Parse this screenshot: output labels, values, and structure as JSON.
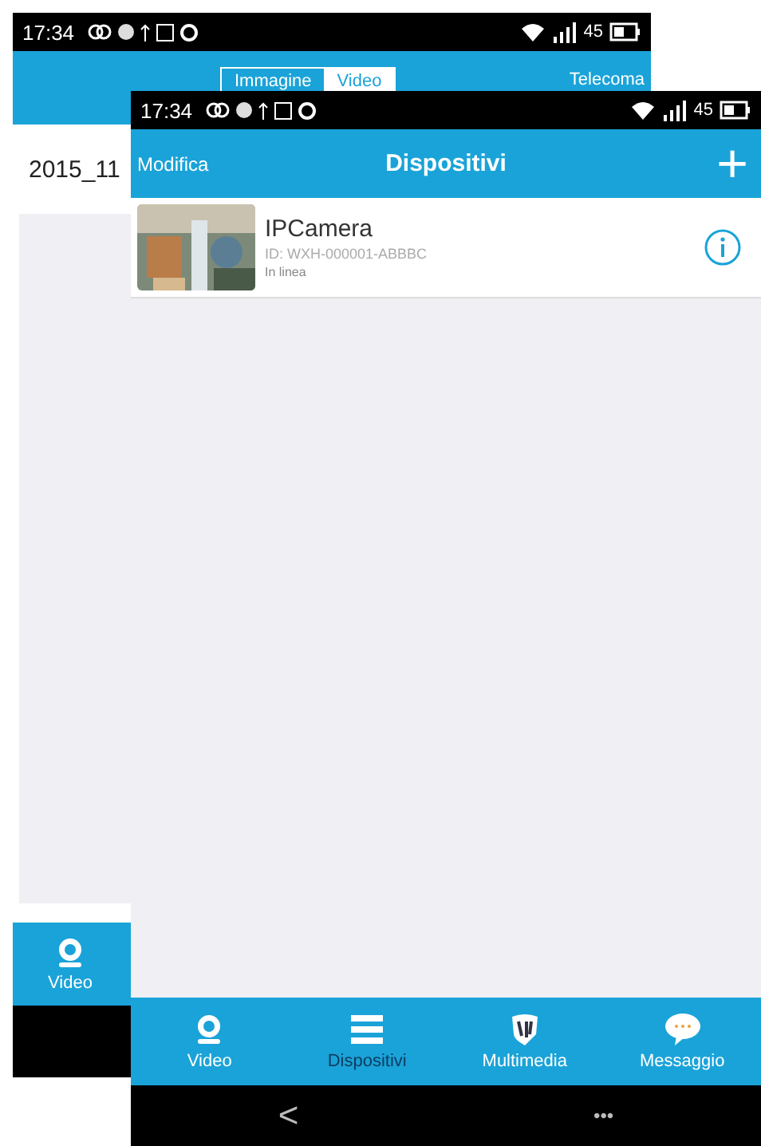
{
  "back_screen": {
    "status_bar": {
      "time": "17:34",
      "battery": "45"
    },
    "segments": [
      {
        "label": "Immagine",
        "selected": false
      },
      {
        "label": "Video",
        "selected": true
      }
    ],
    "header_right": "Telecoma",
    "list_item": "2015_11",
    "bottom_nav": [
      {
        "label": "Video",
        "selected": false
      }
    ]
  },
  "front_screen": {
    "status_bar": {
      "time": "17:34",
      "battery": "45"
    },
    "header": {
      "left": "Modifica",
      "title": "Dispositivi",
      "right": "+"
    },
    "devices": [
      {
        "name": "IPCamera",
        "id": "ID: WXH-000001-ABBBC",
        "status": "In linea"
      }
    ],
    "bottom_nav": [
      {
        "label": "Video",
        "selected": false,
        "kind": "camera"
      },
      {
        "label": "Dispositivi",
        "selected": true,
        "kind": "list"
      },
      {
        "label": "Multimedia",
        "selected": false,
        "kind": "shield"
      },
      {
        "label": "Messaggio",
        "selected": false,
        "kind": "chat"
      }
    ],
    "system_nav": {
      "back": "<",
      "menu": "•••"
    }
  }
}
